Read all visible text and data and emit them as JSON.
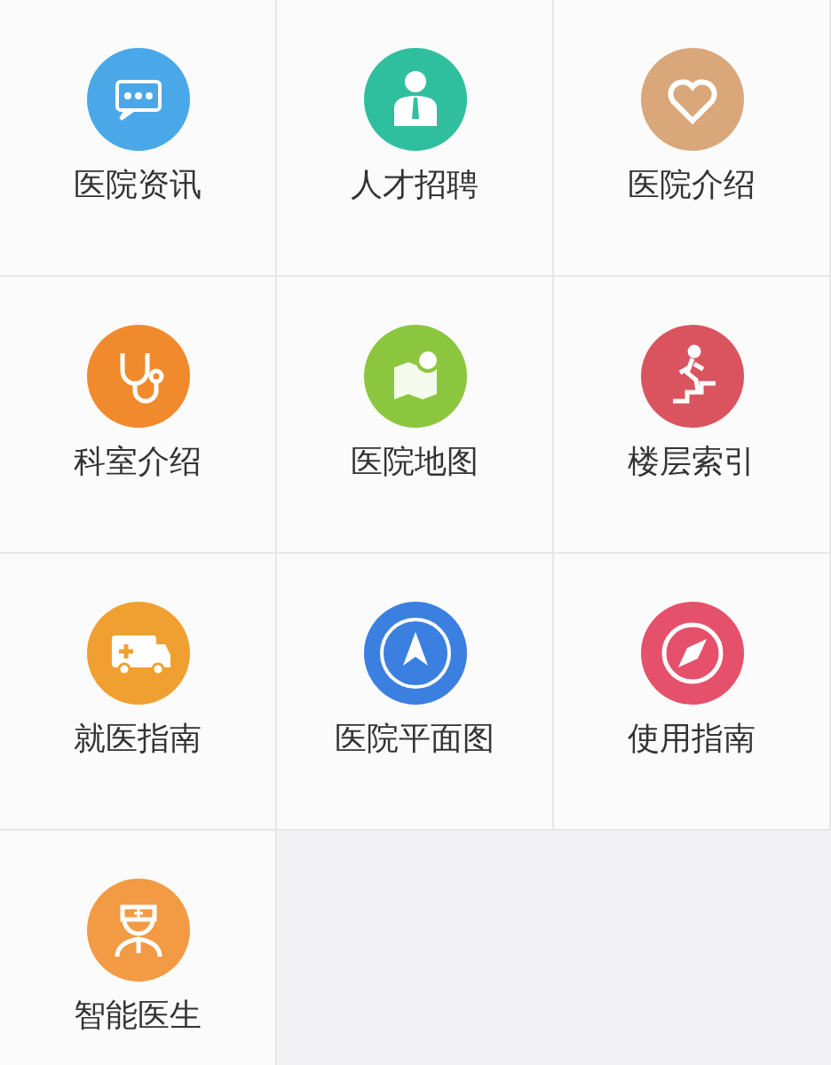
{
  "menu": [
    {
      "label": "医院资讯",
      "color": "#4aa8e8"
    },
    {
      "label": "人才招聘",
      "color": "#2fbf9e"
    },
    {
      "label": "医院介绍",
      "color": "#d9a77a"
    },
    {
      "label": "科室介绍",
      "color": "#f08a2c"
    },
    {
      "label": "医院地图",
      "color": "#8cc63f"
    },
    {
      "label": "楼层索引",
      "color": "#d9545f"
    },
    {
      "label": "就医指南",
      "color": "#f0a030"
    },
    {
      "label": "医院平面图",
      "color": "#3b7fe0"
    },
    {
      "label": "使用指南",
      "color": "#e5506a"
    },
    {
      "label": "智能医生",
      "color": "#f39a45"
    }
  ]
}
